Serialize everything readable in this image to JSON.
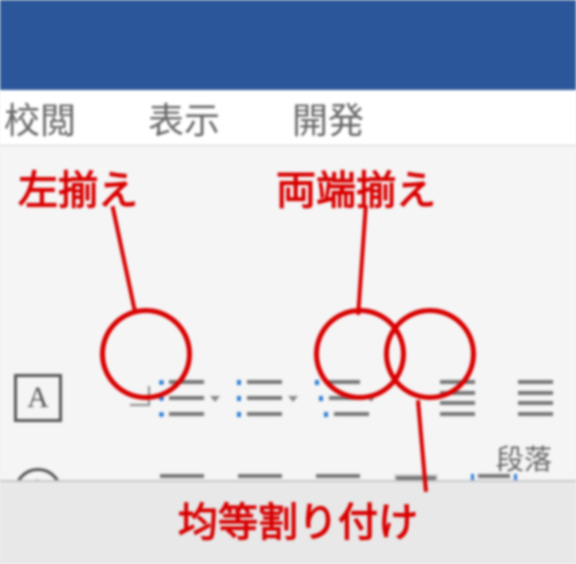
{
  "tabs": {
    "review": "校閲",
    "view": "表示",
    "developer": "開発"
  },
  "annotations": {
    "align_left": "左揃え",
    "justify": "両端揃え",
    "distribute": "均等割り付け"
  },
  "icons": {
    "font_box": "A",
    "char_circle": "字"
  },
  "group": {
    "paragraph": "段落"
  }
}
